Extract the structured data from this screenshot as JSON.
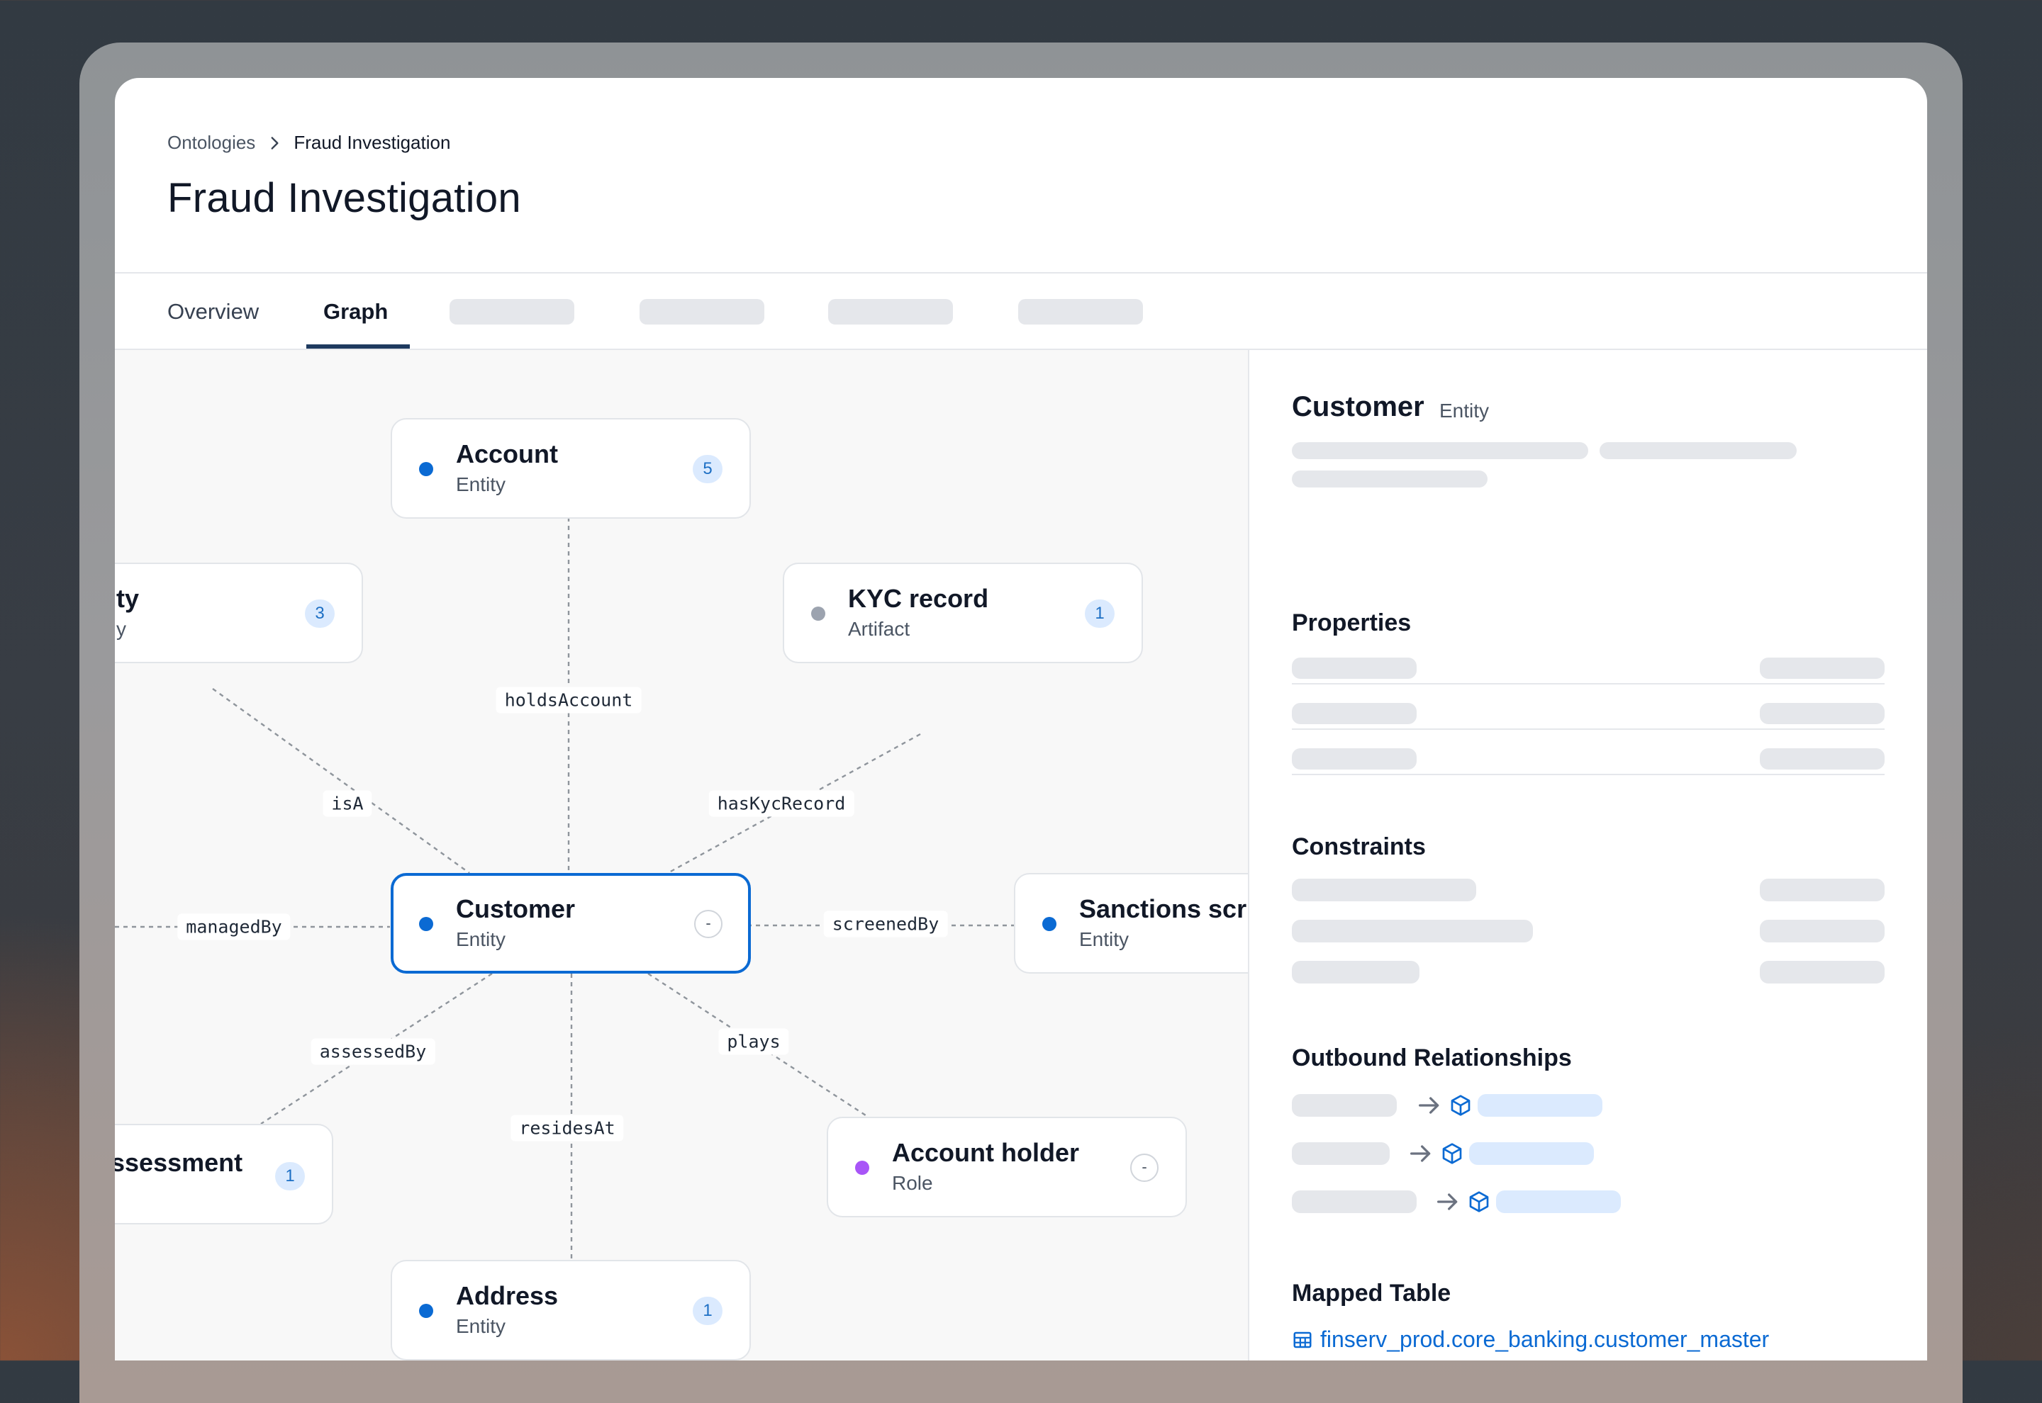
{
  "breadcrumb": {
    "root": "Ontologies",
    "current": "Fraud Investigation"
  },
  "page": {
    "title": "Fraud Investigation"
  },
  "tabs": {
    "overview": "Overview",
    "graph": "Graph",
    "active": "Graph"
  },
  "graph": {
    "nodes": {
      "account": {
        "title": "Account",
        "subtitle": "Entity",
        "badge": "5",
        "dot_color": "#0b6ad3"
      },
      "party": {
        "title": "ty",
        "subtitle": "y",
        "badge": "3",
        "dot_color": "#0b6ad3"
      },
      "kyc": {
        "title": "KYC record",
        "subtitle": "Artifact",
        "badge": "1",
        "dot_color": "#9ca3af"
      },
      "customer": {
        "title": "Customer",
        "subtitle": "Entity",
        "action": "-",
        "dot_color": "#0b6ad3",
        "selected": true
      },
      "sanctions": {
        "title": "Sanctions scr",
        "subtitle": "Entity",
        "dot_color": "#0b6ad3"
      },
      "assessment": {
        "title": "ssessment",
        "badge": "1"
      },
      "account_holder": {
        "title": "Account holder",
        "subtitle": "Role",
        "action": "-",
        "dot_color": "#a855f7"
      },
      "address": {
        "title": "Address",
        "subtitle": "Entity",
        "badge": "1",
        "dot_color": "#0b6ad3"
      }
    },
    "edges": {
      "holds_account": "holdsAccount",
      "is_a": "isA",
      "has_kyc_record": "hasKycRecord",
      "managed_by": "managedBy",
      "screened_by": "screenedBy",
      "assessed_by": "assessedBy",
      "plays": "plays",
      "resides_at": "residesAt"
    }
  },
  "panel": {
    "title": "Customer",
    "type": "Entity",
    "sections": {
      "properties": "Properties",
      "constraints": "Constraints",
      "outbound": "Outbound Relationships",
      "mapped_table": "Mapped Table"
    },
    "mapped_table_name": "finserv_prod.core_banking.customer_master"
  },
  "icons": {
    "breadcrumb_separator": "chevron-right-icon",
    "relationship_arrow": "arrow-right-icon",
    "relationship_target": "cube-icon",
    "mapped_table": "table-icon"
  },
  "colors": {
    "accent": "#0b6ad3",
    "badge_bg": "#dbeafe",
    "role_dot": "#a855f7",
    "artifact_dot": "#9ca3af"
  }
}
